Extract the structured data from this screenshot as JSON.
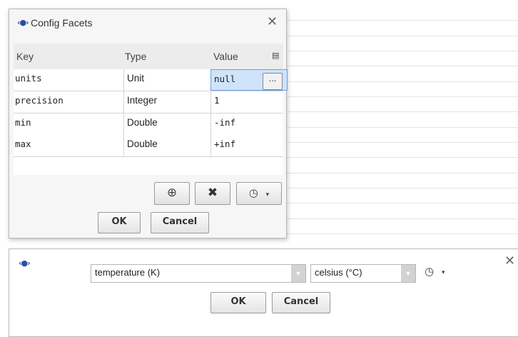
{
  "config_dialog": {
    "title": "Config Facets",
    "close": "✕",
    "headers": {
      "key": "Key",
      "type": "Type",
      "value": "Value"
    },
    "rows": [
      {
        "key": "units",
        "type": "Unit",
        "value": "null"
      },
      {
        "key": "precision",
        "type": "Integer",
        "value": "1"
      },
      {
        "key": "min",
        "type": "Double",
        "value": "-inf"
      },
      {
        "key": "max",
        "type": "Double",
        "value": "+inf"
      }
    ],
    "ellipsis": "...",
    "add_icon": "⊕",
    "delete_icon": "✖",
    "history_icon": "◷",
    "caret": "▾",
    "ok": "OK",
    "cancel": "Cancel"
  },
  "unit_dialog": {
    "close": "✕",
    "quantity": "temperature (K)",
    "unit": "celsius (°C)",
    "history_icon": "◷",
    "caret": "▾",
    "ok": "OK",
    "cancel": "Cancel"
  },
  "colors": {
    "selected_cell": "#cfe3fb",
    "brand": "#2a4fa3"
  }
}
